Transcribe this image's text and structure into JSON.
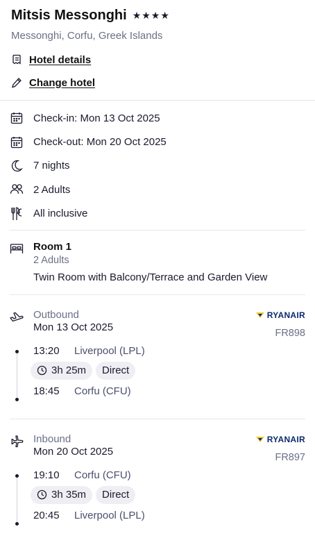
{
  "hotel": {
    "name": "Mitsis Messonghi",
    "stars": "★★★★",
    "location": "Messonghi, Corfu, Greek Islands",
    "details_link": "Hotel details",
    "change_link": "Change hotel"
  },
  "stay": {
    "checkin": "Check-in: Mon 13 Oct 2025",
    "checkout": "Check-out: Mon 20 Oct 2025",
    "nights": "7 nights",
    "guests": "2 Adults",
    "board": "All inclusive"
  },
  "room": {
    "title": "Room 1",
    "adults": "2 Adults",
    "description": "Twin Room with Balcony/Terrace and Garden View"
  },
  "flights": [
    {
      "direction": "Outbound",
      "date": "Mon 13 Oct 2025",
      "airline": "RYANAIR",
      "flight_number": "FR898",
      "depart_time": "13:20",
      "depart_place": "Liverpool (LPL)",
      "duration": "3h 25m",
      "stops": "Direct",
      "arrive_time": "18:45",
      "arrive_place": "Corfu (CFU)"
    },
    {
      "direction": "Inbound",
      "date": "Mon 20 Oct 2025",
      "airline": "RYANAIR",
      "flight_number": "FR897",
      "depart_time": "19:10",
      "depart_place": "Corfu (CFU)",
      "duration": "3h 35m",
      "stops": "Direct",
      "arrive_time": "20:45",
      "arrive_place": "Liverpool (LPL)"
    }
  ],
  "icons": {
    "details": "document-icon",
    "change": "pencil-icon",
    "checkin": "calendar-icon",
    "checkout": "calendar-icon",
    "nights": "moon-icon",
    "guests": "people-icon",
    "board": "cutlery-icon",
    "room": "bed-icon",
    "outbound": "plane-departure-icon",
    "inbound": "plane-arrival-icon",
    "duration": "clock-icon"
  },
  "colors": {
    "text": "#1a1a2e",
    "muted": "#6b6f86",
    "chip_bg": "#efeff3",
    "ryanair_blue": "#0a2a6b",
    "ryanair_yellow": "#f1c933"
  }
}
